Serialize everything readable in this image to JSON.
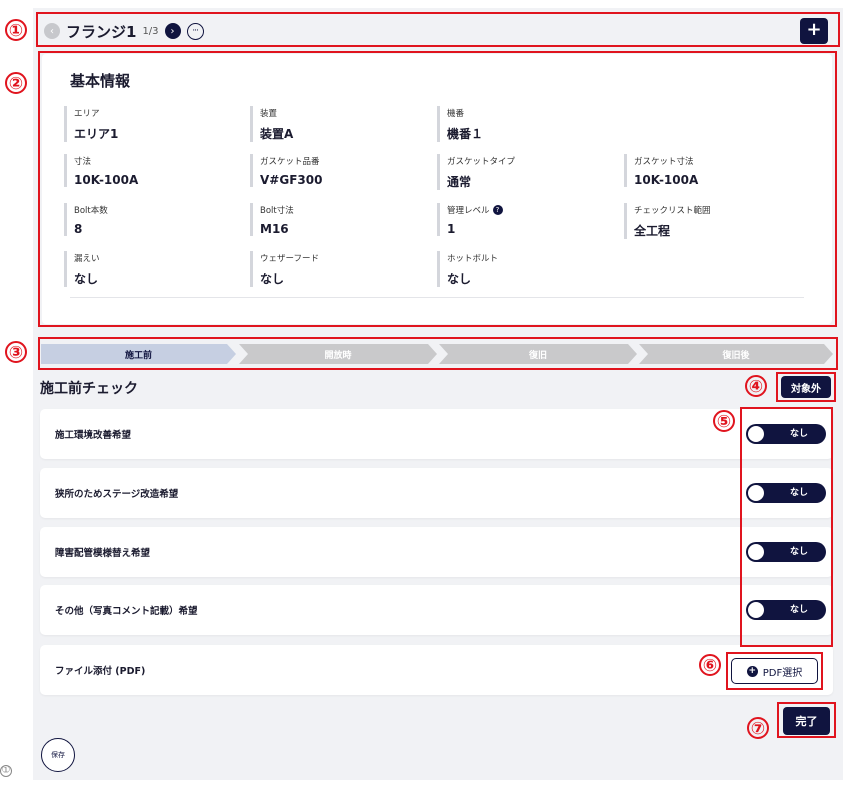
{
  "header": {
    "title": "フランジ1",
    "page": "1/3",
    "prev_icon": "‹",
    "next_icon": "›",
    "more_icon": "···",
    "add_label": "+"
  },
  "info": {
    "title": "基本情報",
    "fields": [
      {
        "label": "エリア",
        "value": "エリア1"
      },
      {
        "label": "装置",
        "value": "装置A"
      },
      {
        "label": "機番",
        "value": "機番１"
      },
      {
        "label": "寸法",
        "value": "10K-100A"
      },
      {
        "label": "ガスケット品番",
        "value": "V#GF300"
      },
      {
        "label": "ガスケットタイプ",
        "value": "通常"
      },
      {
        "label": "ガスケット寸法",
        "value": "10K-100A"
      },
      {
        "label": "Bolt本数",
        "value": "8"
      },
      {
        "label": "Bolt寸法",
        "value": "M16"
      },
      {
        "label": "管理レベル",
        "value": "1",
        "help": "?"
      },
      {
        "label": "チェックリスト範囲",
        "value": "全工程"
      },
      {
        "label": "漏えい",
        "value": "なし"
      },
      {
        "label": "ウェザーフード",
        "value": "なし"
      },
      {
        "label": "ホットボルト",
        "value": "なし"
      }
    ]
  },
  "steps": [
    "施工前",
    "開放時",
    "復旧",
    "復旧後"
  ],
  "checklist": {
    "title": "施工前チェック",
    "exclude_label": "対象外",
    "items": [
      {
        "label": "施工環境改善希望",
        "toggle": "なし"
      },
      {
        "label": "狭所のためステージ改造希望",
        "toggle": "なし"
      },
      {
        "label": "障害配管模様替え希望",
        "toggle": "なし"
      },
      {
        "label": "その他（写真コメント記載）希望",
        "toggle": "なし"
      }
    ],
    "attachment": {
      "label": "ファイル添付 (PDF)",
      "button": "PDF選択",
      "icon": "+"
    }
  },
  "done_label": "完了",
  "save_label": "保存",
  "callouts": [
    "①",
    "②",
    "③",
    "④",
    "⑤",
    "⑥",
    "⑦"
  ],
  "colors": {
    "primary": "#10143f",
    "callout": "#e0141e",
    "step_active": "#c6cfe2",
    "step_inactive": "#c9c9cb"
  }
}
